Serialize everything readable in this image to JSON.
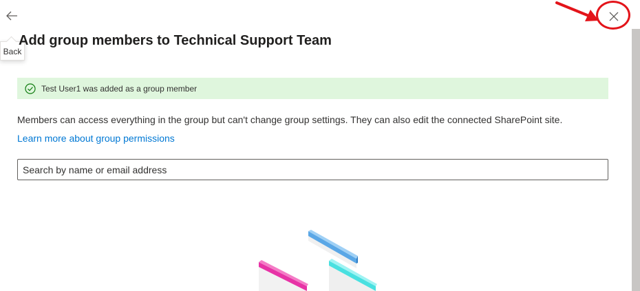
{
  "header": {
    "back_icon": "arrow-left-icon",
    "back_tooltip": "Back",
    "close_icon": "close-icon"
  },
  "page": {
    "title": "Add group members to Technical Support Team"
  },
  "banner": {
    "icon": "success-check-icon",
    "message": "Test User1 was added as a group member",
    "background": "#dff6dd",
    "icon_color": "#107c10"
  },
  "body": {
    "description": "Members can access everything in the group but can't change group settings. They can also edit the connected SharePoint site.",
    "learn_more_link": "Learn more about group permissions"
  },
  "search": {
    "placeholder": "Search by name or email address"
  },
  "annotation": {
    "highlight_color": "#e3141a"
  },
  "colors": {
    "link": "#0078d4",
    "text": "#323130"
  }
}
